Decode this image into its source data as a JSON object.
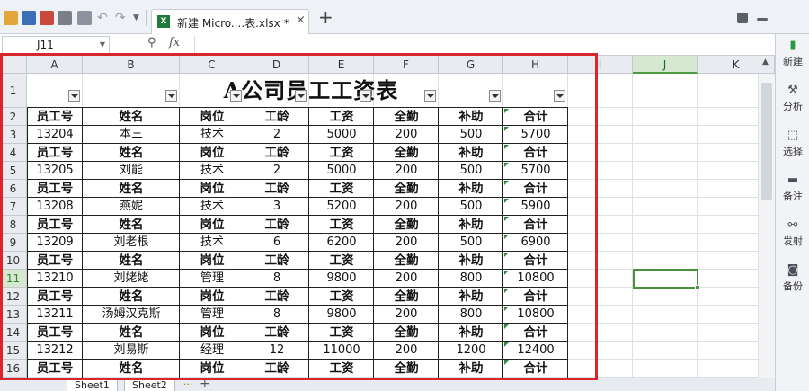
{
  "tab": {
    "title": "新建 Micro....表.xlsx *",
    "close": "×",
    "add": "+"
  },
  "formula_bar": {
    "cell_ref": "J11",
    "fx": "fx",
    "value": ""
  },
  "columns": [
    "A",
    "B",
    "C",
    "D",
    "E",
    "F",
    "G",
    "H",
    "I",
    "J",
    "K"
  ],
  "selected_column": "J",
  "rows": [
    "1",
    "2",
    "3",
    "4",
    "5",
    "6",
    "7",
    "8",
    "9",
    "10",
    "11",
    "12",
    "13",
    "14",
    "15",
    "16"
  ],
  "selected_row": "11",
  "sheet": {
    "title": "A公司员工工资表",
    "header": [
      "员工号",
      "姓名",
      "岗位",
      "工龄",
      "工资",
      "全勤",
      "补助",
      "合计"
    ],
    "records": [
      [
        "13204",
        "本三",
        "技术",
        "2",
        "5000",
        "200",
        "500",
        "5700"
      ],
      [
        "13205",
        "刘能",
        "技术",
        "2",
        "5000",
        "200",
        "500",
        "5700"
      ],
      [
        "13208",
        "燕妮",
        "技术",
        "3",
        "5200",
        "200",
        "500",
        "5900"
      ],
      [
        "13209",
        "刘老根",
        "技术",
        "6",
        "6200",
        "200",
        "500",
        "6900"
      ],
      [
        "13210",
        "刘姥姥",
        "管理",
        "8",
        "9800",
        "200",
        "800",
        "10800"
      ],
      [
        "13211",
        "汤姆汉克斯",
        "管理",
        "8",
        "9800",
        "200",
        "800",
        "10800"
      ],
      [
        "13212",
        "刘易斯",
        "经理",
        "12",
        "11000",
        "200",
        "1200",
        "12400"
      ]
    ]
  },
  "sheet_tabs": [
    "Sheet1",
    "Sheet2"
  ],
  "sheet_more": "···",
  "sheet_add": "+",
  "side_panel": [
    "新建",
    "分析",
    "选择",
    "备注",
    "发射",
    "备份"
  ],
  "colors": {
    "accent_green": "#4b8f3a",
    "highlight_red": "#d8262c",
    "excel_green": "#1e7b3c"
  }
}
